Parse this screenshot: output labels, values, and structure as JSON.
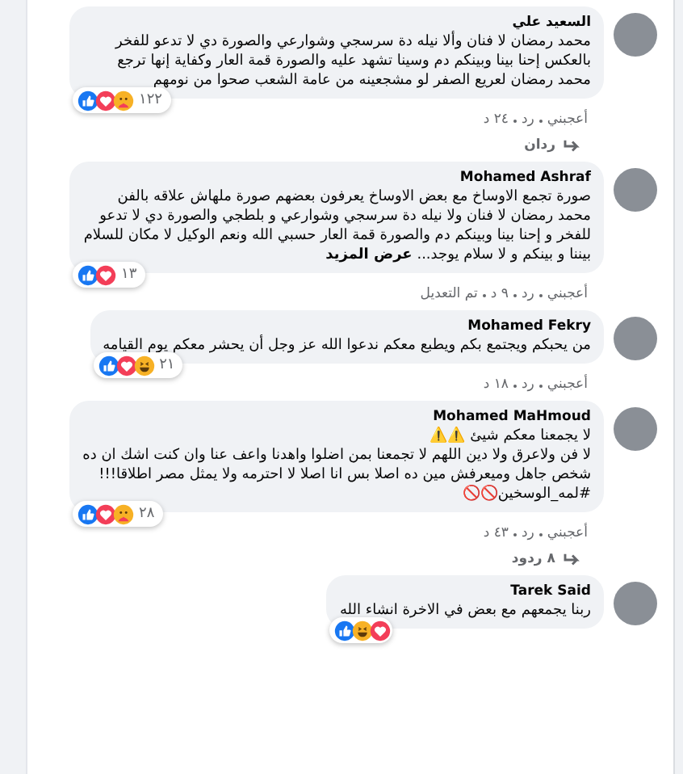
{
  "comments": [
    {
      "author": "السعيد علي",
      "text": "محمد رمضان لا فنان وألا نيله دة سرسجي وشوارعي والصورة دي لا تدعو للفخر بالعكس إحنا بينا وبينكم دم وسينا تشهد عليه والصورة قمة العار وكفاية إنها ترجع محمد رمضان لعريع الصفر لو مشجعينه من عامة الشعب صحوا من نومهم",
      "reactions": [
        {
          "kind": "like"
        },
        {
          "kind": "love"
        },
        {
          "kind": "care"
        }
      ],
      "reaction_count": "١٢٢",
      "actions": [
        "أعجبني",
        "رد",
        "٢٤ د"
      ],
      "replies": "ردان"
    },
    {
      "author": "Mohamed Ashraf",
      "text": "صورة تجمع الاوساخ مع بعض الاوساخ يعرفون بعضهم صورة ملهاش علاقه بالفن محمد رمضان لا فنان ولا نيله دة سرسجي وشوارعي و بلطجي والصورة دي لا تدعو للفخر و إحنا بينا وبينكم دم والصورة قمة العار حسبي الله ونعم الوكيل لا مكان للسلام بيننا و بينكم و لا سلام يوجد...",
      "see_more": "عرض المزيد",
      "reactions": [
        {
          "kind": "like"
        },
        {
          "kind": "love"
        }
      ],
      "reaction_count": "١٣",
      "actions": [
        "أعجبني",
        "رد",
        "٩ د",
        "تم التعديل"
      ]
    },
    {
      "author": "Mohamed Fekry",
      "text": "من يحبكم ويجتمع بكم ويطبع معكم ندعوا الله عز وجل أن يحشر معكم يوم القيامه",
      "reactions": [
        {
          "kind": "like"
        },
        {
          "kind": "love"
        },
        {
          "kind": "haha"
        }
      ],
      "reaction_count": "٢١",
      "actions": [
        "أعجبني",
        "رد",
        "١٨ د"
      ]
    },
    {
      "author": "Mohamed MaHmoud",
      "text": "لا يجمعنا معكم شيئ ⚠️⚠️\nلا فن ولاعرق ولا دين اللهم لا تجمعنا بمن اضلوا واهدنا واعف عنا وان كنت اشك ان ده شخص جاهل وميعرفش مين ده اصلا بس انا اصلا لا احترمه ولا يمثل مصر اطلاقا!!! #لمه_الوسخين🚫🚫",
      "reactions": [
        {
          "kind": "like"
        },
        {
          "kind": "love"
        },
        {
          "kind": "care"
        }
      ],
      "reaction_count": "٢٨",
      "actions": [
        "أعجبني",
        "رد",
        "٤٣ د"
      ],
      "replies": "٨ ردود"
    },
    {
      "author": "Tarek Said",
      "text": "ربنا يجمعهم مع بعض في الاخرة انشاء الله",
      "reactions": [
        {
          "kind": "like"
        },
        {
          "kind": "haha"
        },
        {
          "kind": "love"
        }
      ]
    }
  ]
}
